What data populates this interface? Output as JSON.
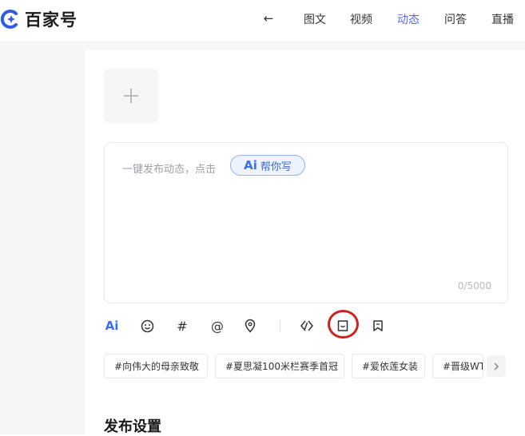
{
  "header": {
    "logo_text": "百家号",
    "back_glyph": "←",
    "nav": [
      {
        "label": "图文",
        "active": false
      },
      {
        "label": "视频",
        "active": false
      },
      {
        "label": "动态",
        "active": true
      },
      {
        "label": "问答",
        "active": false
      },
      {
        "label": "直播",
        "active": false
      }
    ]
  },
  "upload": {
    "icon": "plus-icon",
    "glyph": "+"
  },
  "editor": {
    "placeholder": "一键发布动态，点击",
    "ai_button_mark": "Ai",
    "ai_button_label": "帮你写",
    "counter": "0/5000"
  },
  "toolbar": [
    {
      "name": "ai-tool",
      "text": "Ai"
    },
    {
      "name": "emoji",
      "icon": "smile-icon"
    },
    {
      "name": "topic",
      "text": "#"
    },
    {
      "name": "mention",
      "text": "@"
    },
    {
      "name": "location",
      "icon": "location-pin-icon"
    },
    {
      "name": "link",
      "icon": "link-icon"
    },
    {
      "name": "shop",
      "icon": "shopping-bag-icon"
    },
    {
      "name": "bookmark",
      "icon": "bookmark-icon"
    }
  ],
  "topics": [
    "#向伟大的母亲致敬",
    "#夏思凝100米栏赛季首冠",
    "#爱依莲女装",
    "#晋级WT"
  ],
  "settings": {
    "title": "发布设置"
  },
  "colors": {
    "accent": "#4e6ef2",
    "highlight_ring": "#d0221d",
    "sidebar_bg": "#f5f6f7"
  }
}
